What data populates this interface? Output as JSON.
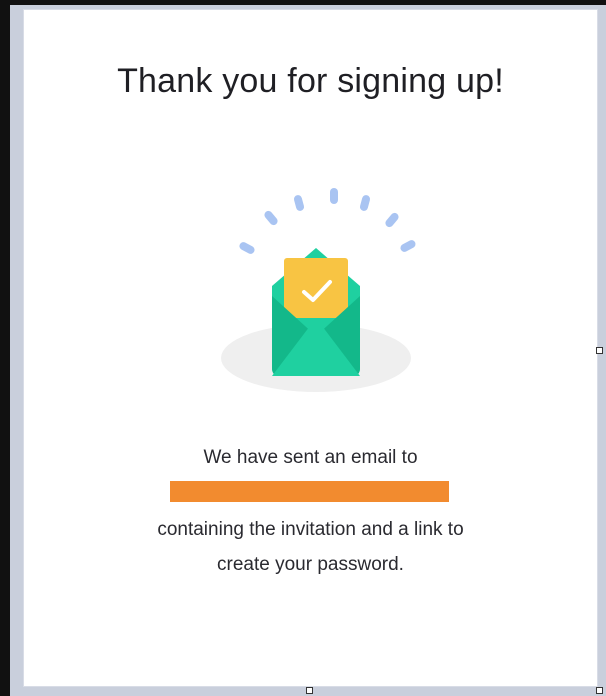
{
  "dialog": {
    "title": "Thank you for signing up!",
    "message_line_1": "We have sent an email to",
    "message_line_2": "containing the invitation and a link to",
    "message_line_3": "create your password."
  },
  "illustration": {
    "icon": "envelope-check-icon",
    "colors": {
      "envelope": "#1fd0a0",
      "envelope_dark": "#13b88a",
      "letter": "#f8c443",
      "checkmark": "#ffffff",
      "rays": "#a9c4f2",
      "shadow": "#efefef"
    }
  },
  "redaction": {
    "color": "#f28b2f"
  }
}
